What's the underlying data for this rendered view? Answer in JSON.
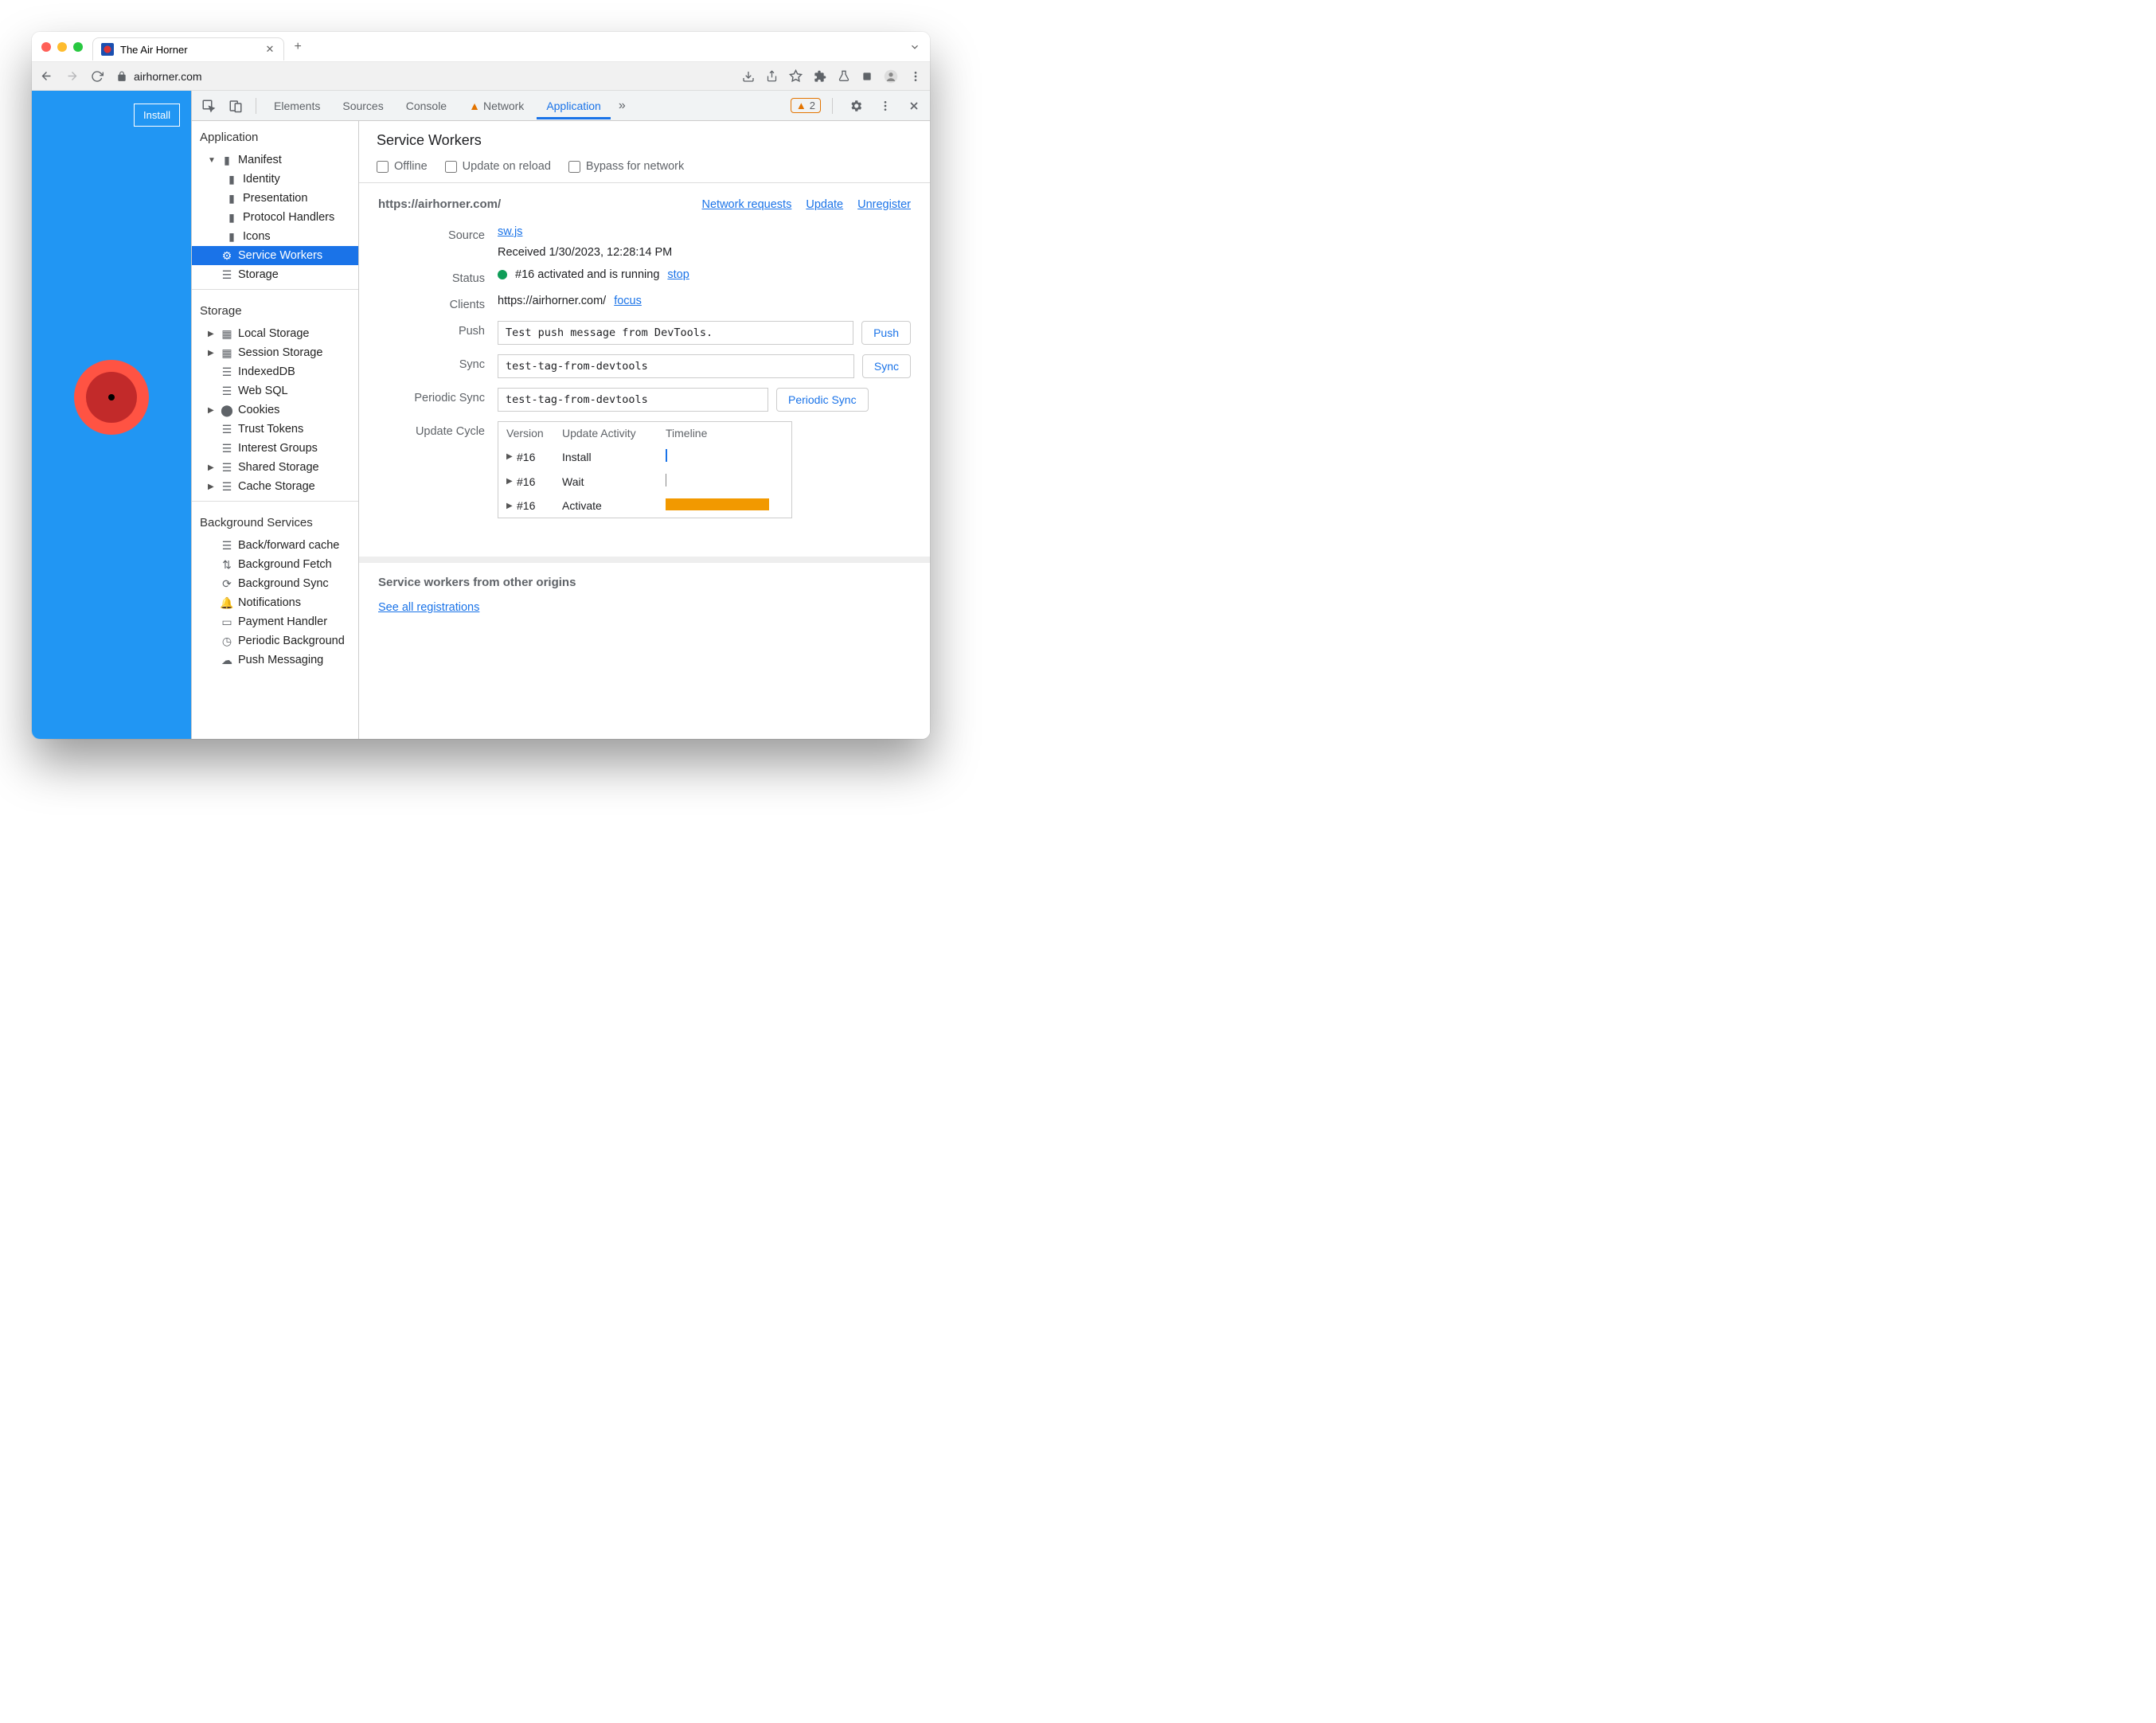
{
  "browser": {
    "tab_title": "The Air Horner",
    "url": "airhorner.com"
  },
  "app": {
    "install_label": "Install"
  },
  "devtools": {
    "tabs": {
      "elements": "Elements",
      "sources": "Sources",
      "console": "Console",
      "network": "Network",
      "application": "Application"
    },
    "warning_count": "2",
    "sidebar": {
      "application": {
        "title": "Application",
        "manifest": "Manifest",
        "identity": "Identity",
        "presentation": "Presentation",
        "protocol_handlers": "Protocol Handlers",
        "icons": "Icons",
        "service_workers": "Service Workers",
        "storage": "Storage"
      },
      "storage": {
        "title": "Storage",
        "local_storage": "Local Storage",
        "session_storage": "Session Storage",
        "indexeddb": "IndexedDB",
        "web_sql": "Web SQL",
        "cookies": "Cookies",
        "trust_tokens": "Trust Tokens",
        "interest_groups": "Interest Groups",
        "shared_storage": "Shared Storage",
        "cache_storage": "Cache Storage"
      },
      "background": {
        "title": "Background Services",
        "back_forward": "Back/forward cache",
        "fetch": "Background Fetch",
        "sync": "Background Sync",
        "notifications": "Notifications",
        "payment": "Payment Handler",
        "periodic": "Periodic Background",
        "push": "Push Messaging"
      }
    },
    "panel": {
      "title": "Service Workers",
      "checks": {
        "offline": "Offline",
        "update_reload": "Update on reload",
        "bypass": "Bypass for network"
      },
      "scope": "https://airhorner.com/",
      "links": {
        "network_requests": "Network requests",
        "update": "Update",
        "unregister": "Unregister"
      },
      "rows": {
        "source_label": "Source",
        "source_link": "sw.js",
        "received": "Received 1/30/2023, 12:28:14 PM",
        "status_label": "Status",
        "status_text": "#16 activated and is running",
        "status_stop": "stop",
        "clients_label": "Clients",
        "clients_url": "https://airhorner.com/",
        "clients_focus": "focus",
        "push_label": "Push",
        "push_value": "Test push message from DevTools.",
        "push_btn": "Push",
        "sync_label": "Sync",
        "sync_value": "test-tag-from-devtools",
        "sync_btn": "Sync",
        "psync_label": "Periodic Sync",
        "psync_value": "test-tag-from-devtools",
        "psync_btn": "Periodic Sync",
        "cycle_label": "Update Cycle",
        "cycle_headers": {
          "version": "Version",
          "activity": "Update Activity",
          "timeline": "Timeline"
        },
        "cycle_rows": [
          {
            "version": "#16",
            "activity": "Install"
          },
          {
            "version": "#16",
            "activity": "Wait"
          },
          {
            "version": "#16",
            "activity": "Activate"
          }
        ]
      },
      "other_origins": {
        "title": "Service workers from other origins",
        "see_all": "See all registrations"
      }
    }
  }
}
